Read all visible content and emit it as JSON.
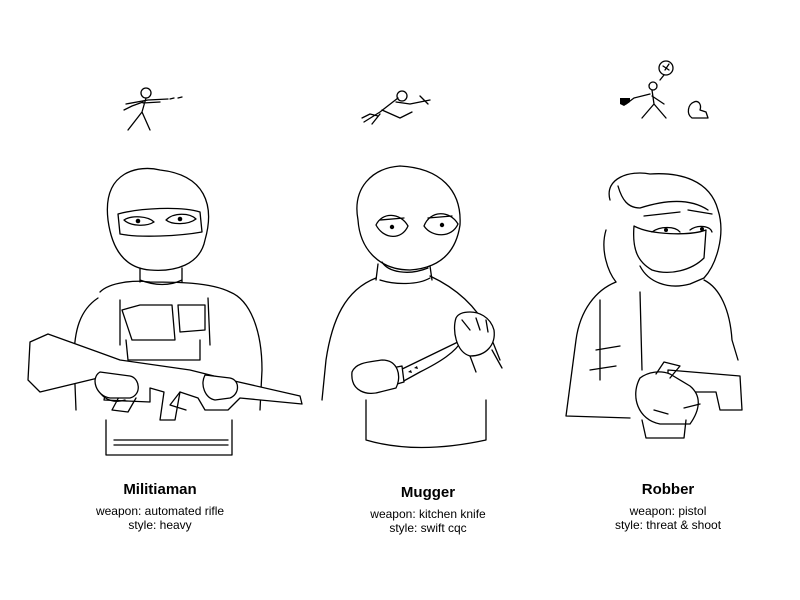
{
  "characters": [
    {
      "name": "Militiaman",
      "weapon": "weapon: automated rifle",
      "style": "style: heavy"
    },
    {
      "name": "Mugger",
      "weapon": "weapon: kitchen knife",
      "style": "style: swift cqc"
    },
    {
      "name": "Robber",
      "weapon": "weapon: pistol",
      "style": "style: threat & shoot"
    }
  ],
  "ink_color": "#000000",
  "paper_color": "#ffffff"
}
